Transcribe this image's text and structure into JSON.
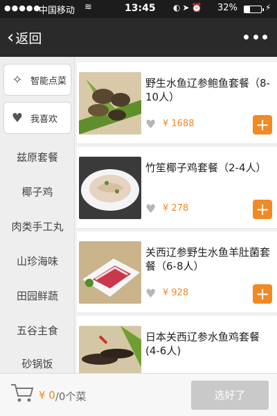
{
  "status_bar": {
    "signal": "●●●●●",
    "carrier": "中国移动",
    "time": "13:45",
    "battery_percent": "32%",
    "battery_level": 0.32
  },
  "nav": {
    "back_label": "返回",
    "back_icon": "chevron-left-icon",
    "more_icon": "ellipsis-icon"
  },
  "sidebar": {
    "smart_order": "智能点菜",
    "favorites": "我喜欢",
    "categories": [
      "兹原套餐",
      "椰子鸡",
      "肉类手工丸",
      "山珍海味",
      "田园鲜蔬",
      "五谷主食",
      "砂锅饭"
    ]
  },
  "dishes": [
    {
      "name": "野生水鱼辽参鲍鱼套餐（8-10人）",
      "price": "¥ 1688"
    },
    {
      "name": "竹笙椰子鸡套餐（2-4人）",
      "price": "¥ 278"
    },
    {
      "name": "关西辽参野生水鱼羊肚菌套餐（6-8人）",
      "price": "¥ 928"
    },
    {
      "name": "日本关西辽参水鱼鸡套餐(4-6人)",
      "price": ""
    }
  ],
  "cart": {
    "amount": "¥ 0",
    "count": "/0个菜",
    "done_label": "选好了"
  },
  "colors": {
    "accent": "#f08a24",
    "nav_bg": "#2a2a2a",
    "status_bg": "#1c1c1c"
  }
}
